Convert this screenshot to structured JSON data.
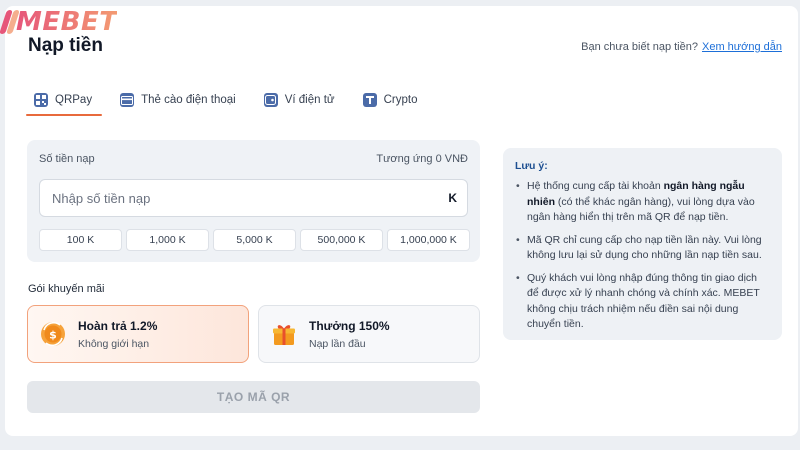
{
  "brand": {
    "logo_text": "MEBET"
  },
  "page": {
    "title": "Nạp tiền",
    "help_text": "Bạn chưa biết nạp tiền?",
    "help_link": "Xem hướng dẫn"
  },
  "tabs": [
    {
      "label": "QRPay",
      "icon": "qr-icon",
      "active": true
    },
    {
      "label": "Thẻ cào điện thoại",
      "icon": "card-icon",
      "active": false
    },
    {
      "label": "Ví điện tử",
      "icon": "wallet-icon",
      "active": false
    },
    {
      "label": "Crypto",
      "icon": "crypto-icon",
      "active": false
    }
  ],
  "amount": {
    "label": "Số tiền nạp",
    "equivalent": "Tương ứng 0 VNĐ",
    "placeholder": "Nhập số tiền nạp",
    "value": "",
    "unit": "K",
    "presets": [
      "100 K",
      "1,000 K",
      "5,000 K",
      "500,000 K",
      "1,000,000 K"
    ]
  },
  "promotions": {
    "label": "Gói khuyến mãi",
    "items": [
      {
        "title": "Hoàn trả 1.2%",
        "subtitle": "Không giới hạn",
        "icon": "cashback-icon",
        "selected": true
      },
      {
        "title": "Thưởng 150%",
        "subtitle": "Nạp lần đầu",
        "icon": "gift-icon",
        "selected": false
      }
    ]
  },
  "submit": {
    "label": "TẠO MÃ QR",
    "enabled": false
  },
  "notes": {
    "title": "Lưu ý:",
    "items": [
      {
        "before": "Hệ thống cung cấp tài khoản ",
        "bold": "ngân hàng ngẫu nhiên",
        "after": " (có thể khác ngân hàng), vui lòng dựa vào ngân hàng hiển thị trên mã QR để nạp tiền."
      },
      {
        "text": "Mã QR chỉ cung cấp cho nạp tiền lần này. Vui lòng không lưu lại sử dụng cho những lần nạp tiền sau."
      },
      {
        "text": "Quý khách vui lòng nhập đúng thông tin giao dịch để được xử lý nhanh chóng và chính xác. MEBET không chịu trách nhiệm nếu điền sai nội dung chuyển tiền."
      }
    ]
  },
  "colors": {
    "accent": "#e86a3c",
    "link": "#1d6fd8",
    "note_title": "#1d4f91",
    "tab_icon": "#4b6ba8",
    "logo_gradient": [
      "#e6567a",
      "#f39a72"
    ]
  }
}
